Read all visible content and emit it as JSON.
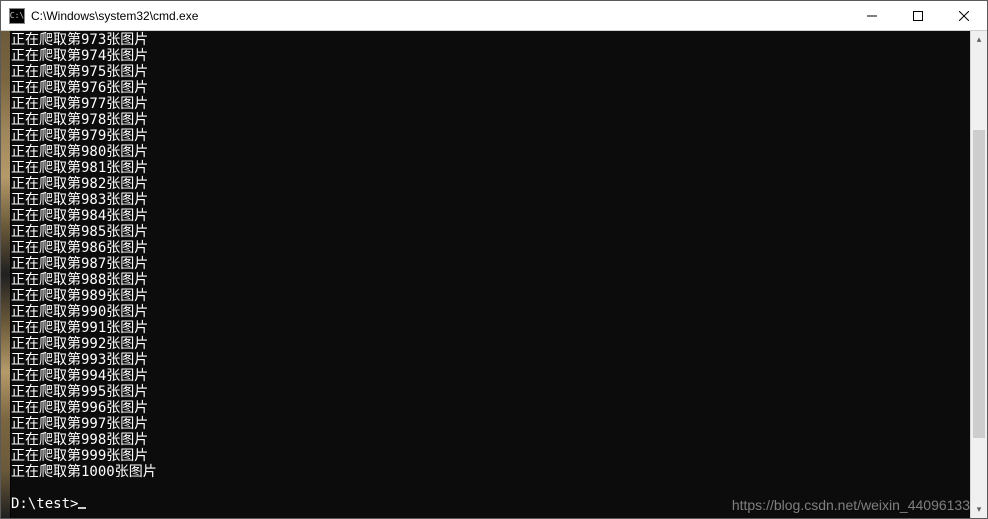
{
  "window": {
    "icon_text": "C:\\",
    "title": "C:\\Windows\\system32\\cmd.exe"
  },
  "console": {
    "line_prefix": "正在爬取第",
    "line_suffix": "张图片",
    "start_number": 973,
    "end_number": 1000,
    "prompt": "D:\\test>"
  },
  "scrollbar": {
    "thumb_top_pct": 18,
    "thumb_height_pct": 68
  },
  "watermark": "https://blog.csdn.net/weixin_44096133"
}
